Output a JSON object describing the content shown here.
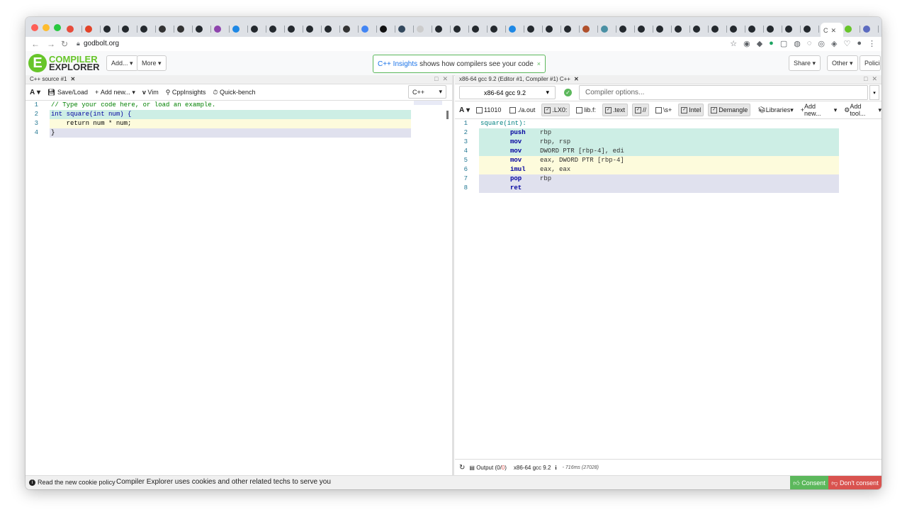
{
  "browser": {
    "url": "godbolt.org",
    "new_tab_symbol": "+",
    "favicon_colors": [
      "#e74c3c",
      "#e24329",
      "#24292e",
      "#24292e",
      "#24292e",
      "#333333",
      "#333333",
      "#24292e",
      "#8e44ad",
      "#1e88e5",
      "#24292e",
      "#24292e",
      "#24292e",
      "#24292e",
      "#24292e",
      "#333333",
      "#4285f4",
      "#111111",
      "#34495e",
      "#cccccc",
      "#24292e",
      "#24292e",
      "#24292e",
      "#24292e",
      "#1e88e5",
      "#24292e",
      "#24292e",
      "#24292e",
      "#b0502c",
      "#4a90a4",
      "#24292e",
      "#24292e",
      "#24292e",
      "#24292e",
      "#24292e",
      "#24292e",
      "#24292e",
      "#24292e",
      "#24292e",
      "#24292e",
      "#24292e",
      "#67c52a",
      "#5c6bc0"
    ],
    "active_tab_label": "C",
    "active_tab_close": "✕"
  },
  "header": {
    "logo_line1": "COMPILER",
    "logo_line2": "EXPLORER",
    "add_btn": "Add...",
    "more_btn": "More",
    "insights_link": "C++ Insights",
    "insights_text": "shows how compilers see your code",
    "insights_close": "×",
    "share_btn": "Share",
    "other_btn": "Other",
    "policies_btn": "Policies"
  },
  "source_pane": {
    "tab_title": "C++ source #1",
    "tab_close": "✕",
    "toolbar": {
      "font_btn": "A",
      "save_load": "Save/Load",
      "add_new": "Add new...",
      "vim": "Vim",
      "cppinsights": "CppInsights",
      "quickbench": "Quick-bench"
    },
    "language": "C++",
    "lines": [
      {
        "n": "1",
        "text": "// Type your code here, or load an example.",
        "color": "#008000",
        "bg": ""
      },
      {
        "n": "2",
        "text": "int square(int num) {",
        "color": "#00009f",
        "bg": "#cdeee5"
      },
      {
        "n": "3",
        "text": "    return num * num;",
        "color": "#000000",
        "bg": "#fdfbdc"
      },
      {
        "n": "4",
        "text": "}",
        "color": "#000000",
        "bg": "#e0e1ee"
      }
    ]
  },
  "compiler_pane": {
    "tab_title": "x86-64 gcc 9.2 (Editor #1, Compiler #1) C++",
    "tab_close": "✕",
    "compiler": "x86-64 gcc 9.2",
    "options_placeholder": "Compiler options...",
    "filters": [
      {
        "label": "11010",
        "checked": false
      },
      {
        "label": "./a.out",
        "checked": false
      },
      {
        "label": ".LX0:",
        "checked": true
      },
      {
        "label": "lib.f:",
        "checked": false
      },
      {
        "label": ".text",
        "checked": true
      },
      {
        "label": "//",
        "checked": true
      },
      {
        "label": "\\s+",
        "checked": false
      },
      {
        "label": "Intel",
        "checked": true
      },
      {
        "label": "Demangle",
        "checked": true
      }
    ],
    "libraries": "Libraries",
    "add_new": "Add new...",
    "add_tool": "Add tool...",
    "asm": [
      {
        "n": "1",
        "label": "square(int):",
        "op": "",
        "args": "",
        "bg": ""
      },
      {
        "n": "2",
        "label": "",
        "op": "push",
        "args": "rbp",
        "bg": "#cdeee5"
      },
      {
        "n": "3",
        "label": "",
        "op": "mov",
        "args": "rbp, rsp",
        "bg": "#cdeee5"
      },
      {
        "n": "4",
        "label": "",
        "op": "mov",
        "args": "DWORD PTR [rbp-4], edi",
        "bg": "#cdeee5"
      },
      {
        "n": "5",
        "label": "",
        "op": "mov",
        "args": "eax, DWORD PTR [rbp-4]",
        "bg": "#fdfbdc"
      },
      {
        "n": "6",
        "label": "",
        "op": "imul",
        "args": "eax, eax",
        "bg": "#fdfbdc"
      },
      {
        "n": "7",
        "label": "",
        "op": "pop",
        "args": "rbp",
        "bg": "#e0e1ee"
      },
      {
        "n": "8",
        "label": "",
        "op": "ret",
        "args": "",
        "bg": "#e0e1ee"
      }
    ],
    "status": {
      "output_label": "Output",
      "output_open": "(",
      "output_ok": "0",
      "output_sep": "/",
      "output_err": "0",
      "output_close": ")",
      "compiler": "x86-64 gcc 9.2",
      "info_icon": "i",
      "timing": "- 716ms (27028)"
    }
  },
  "cookie_bar": {
    "policy_link": "Read the new cookie policy",
    "message": "Compiler Explorer uses cookies and other related techs to serve you",
    "consent": "Consent",
    "dont_consent": "Don't consent"
  },
  "colors": {
    "brand_green": "#67c52a",
    "consent_green": "#5cb85c",
    "reject_red": "#d9534f",
    "link_blue": "#1a73e8"
  }
}
